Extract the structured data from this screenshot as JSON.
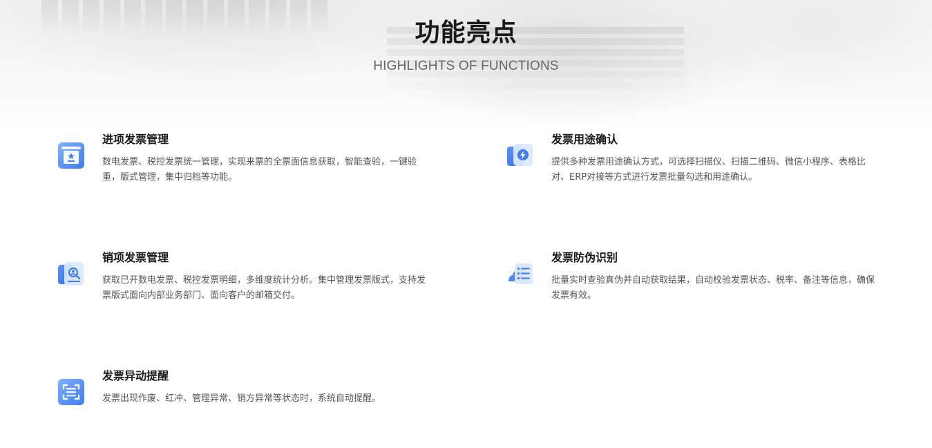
{
  "header": {
    "title": "功能亮点",
    "subtitle": "HIGHLIGHTS OF FUNCTIONS"
  },
  "features": [
    {
      "icon": "inbox-star-icon",
      "title": "进项发票管理",
      "description": "数电发票、税控发票统一管理，实现来票的全票面信息获取，智能查验，一键验重，版式管理，集中归档等功能。"
    },
    {
      "icon": "document-lightning-icon",
      "title": "发票用途确认",
      "description": "提供多种发票用途确认方式，可选择扫描仪、扫描二维码、微信小程序、表格比对、ERP对接等方式进行发票批量勾选和用途确认。"
    },
    {
      "icon": "search-user-icon",
      "title": "销项发票管理",
      "description": "获取已开数电发票、税控发票明细，多维度统计分析。集中管理发票版式，支持发票版式面向内部业务部门、面向客户的邮箱交付。"
    },
    {
      "icon": "cloud-list-icon",
      "title": "发票防伪识别",
      "description": "批量实时查验真伪并自动获取结果，自动校验发票状态、税率、备注等信息，确保发票有效。"
    },
    {
      "icon": "scan-frame-icon",
      "title": "发票异动提醒",
      "description": "发票出现作废、红冲、管理异常、销方异常等状态时，系统自动提醒。"
    }
  ],
  "colors": {
    "icon_primary": "#3f7cf0",
    "icon_light": "#8fb6ff",
    "title": "#1a1a1a",
    "text": "#555555"
  }
}
